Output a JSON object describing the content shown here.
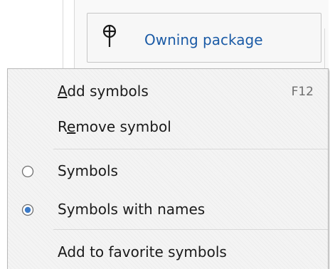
{
  "background": {
    "owning_package_button": {
      "label": "Owning package",
      "icon": "pin-icon"
    }
  },
  "context_menu": {
    "items": [
      {
        "label_prefix": "",
        "label_mnemonic": "A",
        "label_rest": "dd symbols",
        "shortcut": "F12"
      },
      {
        "label_prefix": "R",
        "label_mnemonic": "e",
        "label_rest": "move symbol",
        "shortcut": ""
      }
    ],
    "radio_options": [
      {
        "label": "Symbols",
        "selected": false
      },
      {
        "label": "Symbols with names",
        "selected": true
      }
    ],
    "favorites_item": {
      "label": "Add to favorite symbols"
    }
  },
  "colors": {
    "link_blue": "#1b5ba6",
    "radio_selected": "#3b7ac7",
    "menu_background": "#f4f4f4"
  }
}
